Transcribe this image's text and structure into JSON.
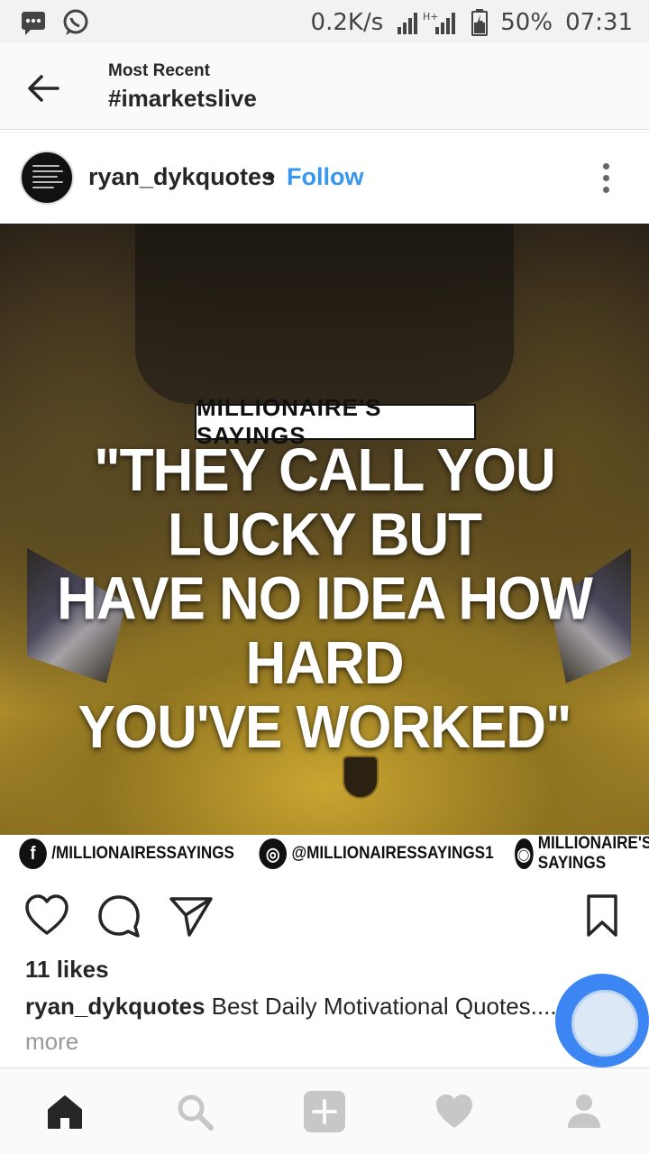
{
  "status_bar": {
    "speed": "0.2K/s",
    "network": "H+",
    "battery": "50%",
    "time": "07:31",
    "icons": [
      "message-icon",
      "whatsapp-icon",
      "signal-icon",
      "battery-icon"
    ]
  },
  "header": {
    "subtitle": "Most Recent",
    "title": "#imarketslive"
  },
  "post": {
    "username": "ryan_dykquotes",
    "separator": "•",
    "follow_label": "Follow",
    "image": {
      "brand": "MILLIONAIRE'S SAYINGS",
      "quote_lines": [
        "\"THEY CALL YOU LUCKY BUT",
        "HAVE NO IDEA HOW HARD",
        "YOU'VE WORKED\""
      ],
      "social": [
        {
          "icon": "f",
          "label": "/MILLIONAIRESSAYINGS"
        },
        {
          "icon": "◎",
          "label": "@MILLIONAIRESSAYINGS1"
        },
        {
          "icon": "◉",
          "label": "MILLIONAIRE'S SAYINGS"
        }
      ]
    },
    "likes": "11 likes",
    "caption_user": "ryan_dykquotes",
    "caption_text": " Best Daily Motivational Quotes....",
    "more_label": "more"
  },
  "colors": {
    "accent": "#3897f0",
    "fab": "#3b86f2"
  }
}
